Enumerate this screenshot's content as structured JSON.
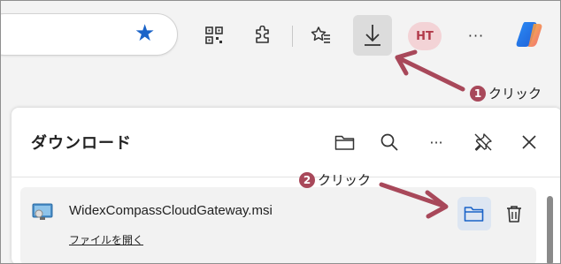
{
  "toolbar": {
    "avatar_initials": "HT",
    "more_label": "···",
    "accent_color": "#1a63c8"
  },
  "download_panel": {
    "title": "ダウンロード",
    "item": {
      "filename": "WidexCompassCloudGateway.msi",
      "open_link": "ファイルを開く"
    }
  },
  "annotations": {
    "step1": {
      "number": "1",
      "text": "クリック"
    },
    "step2": {
      "number": "2",
      "text": "クリック"
    },
    "arrow_color": "#a8485a"
  }
}
